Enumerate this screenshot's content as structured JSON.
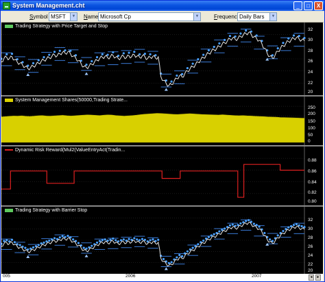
{
  "window": {
    "title": "System Management.cht",
    "minimize": "_",
    "maximize": "□",
    "close": "X"
  },
  "toolbar": {
    "symbol_label_u": "S",
    "symbol_label_rest": "ymbol",
    "symbol_value": "MSFT",
    "name_label_u": "N",
    "name_label_rest": "ame",
    "name_value": "Microsoft Cp",
    "frequency_label_u": "F",
    "frequency_label_rest": "requency",
    "frequency_value": "Daily Bars",
    "dropdown_glyph": "▼"
  },
  "panes": [
    {
      "legend": "Trading Strategy with Price Target and Stop",
      "legend_color": "#5ec95e",
      "axis": [
        "32",
        "30",
        "28",
        "26",
        "24",
        "22",
        "20"
      ],
      "axis_min": 20,
      "axis_max": 33
    },
    {
      "legend": "System Management Shares(50000,Trading Strate...",
      "legend_color": "#d8d000",
      "axis": [
        "250",
        "200",
        "150",
        "100",
        "50",
        "0"
      ],
      "axis_min": 0,
      "axis_max": 260
    },
    {
      "legend": "Dynamic Risk Reward(Mul2(ValueEntryAct(Tradin...",
      "legend_color": "#e02020",
      "axis": [
        "0.88",
        "0.86",
        "0.84",
        "0.82",
        "0.80"
      ],
      "axis_min": 0.79,
      "axis_max": 0.89
    },
    {
      "legend": "Trading Strategy with Barrier Stop",
      "legend_color": "#5ec95e",
      "axis": [
        "32",
        "30",
        "28",
        "26",
        "24",
        "22",
        "20"
      ],
      "axis_min": 20,
      "axis_max": 33
    }
  ],
  "colors": {
    "price": "#e8e8e8",
    "bands": "#3a7bd8",
    "stops": "#4aa0ff",
    "shares_fill": "#d8d000",
    "risk_line": "#e02020",
    "grid": "#2a2a2a"
  },
  "date_axis": {
    "ticks": [
      "005",
      "2006",
      "2007"
    ],
    "left_arrow": "◄",
    "right_arrow": "►"
  },
  "series": {
    "price": [
      26.2,
      26.9,
      27.1,
      26.8,
      27.2,
      26.6,
      26.1,
      25.9,
      25.5,
      25.2,
      24.8,
      25.0,
      25.3,
      25.6,
      25.9,
      26.3,
      26.5,
      26.8,
      27.0,
      27.3,
      27.6,
      27.4,
      27.8,
      28.1,
      27.9,
      28.2,
      27.8,
      27.3,
      26.9,
      26.4,
      25.8,
      25.2,
      25.0,
      25.3,
      25.7,
      26.1,
      26.5,
      26.9,
      27.1,
      27.3,
      27.0,
      27.2,
      27.5,
      27.1,
      26.8,
      27.1,
      27.3,
      27.0,
      27.4,
      27.2,
      27.6,
      27.3,
      27.1,
      27.4,
      27.2,
      26.8,
      27.1,
      27.3,
      26.9,
      27.2,
      23.2,
      22.4,
      21.8,
      21.4,
      21.6,
      22.3,
      22.8,
      23.4,
      23.1,
      23.8,
      24.3,
      24.8,
      25.2,
      25.6,
      26.1,
      26.6,
      27.0,
      27.5,
      27.9,
      28.3,
      28.6,
      28.9,
      29.3,
      29.7,
      30.0,
      30.4,
      30.8,
      31.0,
      30.7,
      30.9,
      31.3,
      31.6,
      31.9,
      32.1,
      31.7,
      31.2,
      30.9,
      30.5,
      29.8,
      28.9,
      27.9,
      27.3,
      26.9,
      27.6,
      28.3,
      28.9,
      29.4,
      29.9,
      30.3,
      30.6,
      30.9,
      31.1,
      30.8,
      30.6,
      30.4
    ],
    "shares": [
      190,
      192,
      195,
      197,
      196,
      198,
      195,
      193,
      196,
      199,
      200,
      197,
      196,
      198,
      200,
      202,
      199,
      197,
      199,
      201,
      203,
      205,
      204,
      202,
      200,
      203,
      205,
      204,
      200,
      198,
      196,
      198,
      200,
      203,
      207,
      210,
      212,
      214,
      216,
      215,
      213,
      211,
      209,
      208,
      210,
      212,
      214,
      212,
      210,
      208,
      207,
      206,
      205,
      204,
      206,
      204,
      202,
      200,
      199,
      200,
      198,
      197,
      195,
      193,
      192,
      190,
      189,
      188,
      186,
      185,
      184,
      183,
      182,
      181,
      180
    ],
    "risk_levels": [
      {
        "from": 0.0,
        "to": 0.03,
        "v": 0.818
      },
      {
        "from": 0.03,
        "to": 0.15,
        "v": 0.862
      },
      {
        "from": 0.15,
        "to": 0.24,
        "v": 0.832
      },
      {
        "from": 0.24,
        "to": 0.53,
        "v": 0.862
      },
      {
        "from": 0.53,
        "to": 0.59,
        "v": 0.844
      },
      {
        "from": 0.59,
        "to": 0.78,
        "v": 0.862
      },
      {
        "from": 0.78,
        "to": 0.8,
        "v": 0.798
      },
      {
        "from": 0.8,
        "to": 0.92,
        "v": 0.878
      },
      {
        "from": 0.92,
        "to": 1.0,
        "v": 0.864
      }
    ]
  }
}
